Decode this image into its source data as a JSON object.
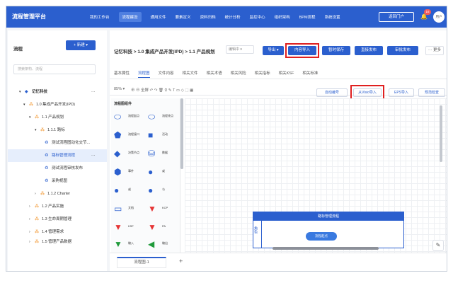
{
  "app": {
    "title": "流程管理平台"
  },
  "nav": [
    "我的工作台",
    "流程建设",
    "通用文件",
    "要素定义",
    "资料归档",
    "统计分析",
    "监控中心",
    "组织架构",
    "BPM流程",
    "系统设置"
  ],
  "header": {
    "portal_label": "返回门户",
    "bell_icon": "bell-icon",
    "notification_count": "16",
    "avatar_text": "用户"
  },
  "sidebar": {
    "title": "流程",
    "new_label": "+ 新建 ▾",
    "search_placeholder": "搜索架构、流程",
    "tree": [
      {
        "label": "记忆科技",
        "arrow": "▾",
        "icon": "◆"
      },
      {
        "label": "1.0 集成产品开发(IPD)",
        "arrow": "▾",
        "icon": "⁂"
      },
      {
        "label": "1.1 产品规划",
        "arrow": "▾",
        "icon": "⁂"
      },
      {
        "label": "1.1.1 路标",
        "arrow": "▾",
        "icon": "⁂"
      },
      {
        "label": "测试流程图动化交节...",
        "arrow": "",
        "icon": "♻"
      },
      {
        "label": "路标管理流程",
        "arrow": "",
        "icon": "♻",
        "more": "···"
      },
      {
        "label": "测试流程审核发布",
        "arrow": "",
        "icon": "♻"
      },
      {
        "label": "采购视图",
        "arrow": "",
        "icon": "♻"
      },
      {
        "label": "1.1.2 Charter",
        "arrow": "›",
        "icon": "⁂"
      },
      {
        "label": "1.2 产品实施",
        "arrow": "›",
        "icon": "⁂"
      },
      {
        "label": "1.3 生命周期管理",
        "arrow": "›",
        "icon": "⁂"
      },
      {
        "label": "1.4 管理需求",
        "arrow": "›",
        "icon": "⁂"
      },
      {
        "label": "1.5 管理产品数据",
        "arrow": "›",
        "icon": "⁂"
      }
    ],
    "tree_more": "···"
  },
  "main": {
    "breadcrumb": "记忆科技 > 1.0 集成产品开发(IPD) > 1.1 产品规划",
    "edit_select": "编辑中 ▾",
    "buttons": {
      "export": "导出 ▾",
      "content_import": "内容导入",
      "temp_save": "暂时保存",
      "direct_publish": "直接发布",
      "review_publish": "审批发布",
      "more": "··· 更多"
    },
    "tabs": [
      "基本属性",
      "流程图",
      "文件内容",
      "相关文件",
      "相关术语",
      "相关风险",
      "相关指标",
      "相关KSF",
      "相关标准"
    ],
    "toolbar": {
      "zoom": "85% ▾",
      "tools": "⊕  ⊖  全屏   ↶  ↷   🗑   ⚲  ✎  T  ▭  ◇  ⬚  ▦"
    },
    "outline_buttons": {
      "auto_number": "自动编号",
      "visio_import": "从Visio导入",
      "eps_import": "EPS导入",
      "spec_check": "规范检查"
    },
    "palette": {
      "title": "流程图组件",
      "shapes": [
        {
          "glyph": "⬭",
          "color": "#2b5fce",
          "text": "流程起点"
        },
        {
          "glyph": "⬭",
          "color": "#2b5fce",
          "text": "流程终点"
        },
        {
          "glyph": "⬟",
          "color": "#2b5fce",
          "text": "流程接口"
        },
        {
          "glyph": "■",
          "color": "#2b5fce",
          "text": "活动"
        },
        {
          "glyph": "◆",
          "color": "#2b5fce",
          "text": "决策节点"
        },
        {
          "glyph": "⛁",
          "color": "#2b5fce",
          "text": "数据"
        },
        {
          "glyph": "⬢",
          "color": "#2b5fce",
          "text": "事件"
        },
        {
          "glyph": "●",
          "color": "#2b5fce",
          "text": "或"
        },
        {
          "glyph": "●",
          "color": "#2b5fce",
          "text": "或"
        },
        {
          "glyph": "●",
          "color": "#2b5fce",
          "text": "与"
        },
        {
          "glyph": "▭",
          "color": "#2b5fce",
          "text": "文档"
        },
        {
          "glyph": "▼",
          "color": "#e63535",
          "text": "KCP"
        },
        {
          "glyph": "▼",
          "color": "#e63535",
          "text": "KSF"
        },
        {
          "glyph": "▼",
          "color": "#e63535",
          "text": "PA"
        },
        {
          "glyph": "▼",
          "color": "#1f9a3a",
          "text": "输入"
        },
        {
          "glyph": "◀",
          "color": "#1f9a3a",
          "text": "输出"
        }
      ]
    },
    "canvas": {
      "pool_title": "路标管理流程",
      "lane_label": "角色",
      "node_label": "流程起点"
    },
    "page_tab": "流程图-1",
    "add_tab": "+",
    "edit_icon": "✎"
  }
}
